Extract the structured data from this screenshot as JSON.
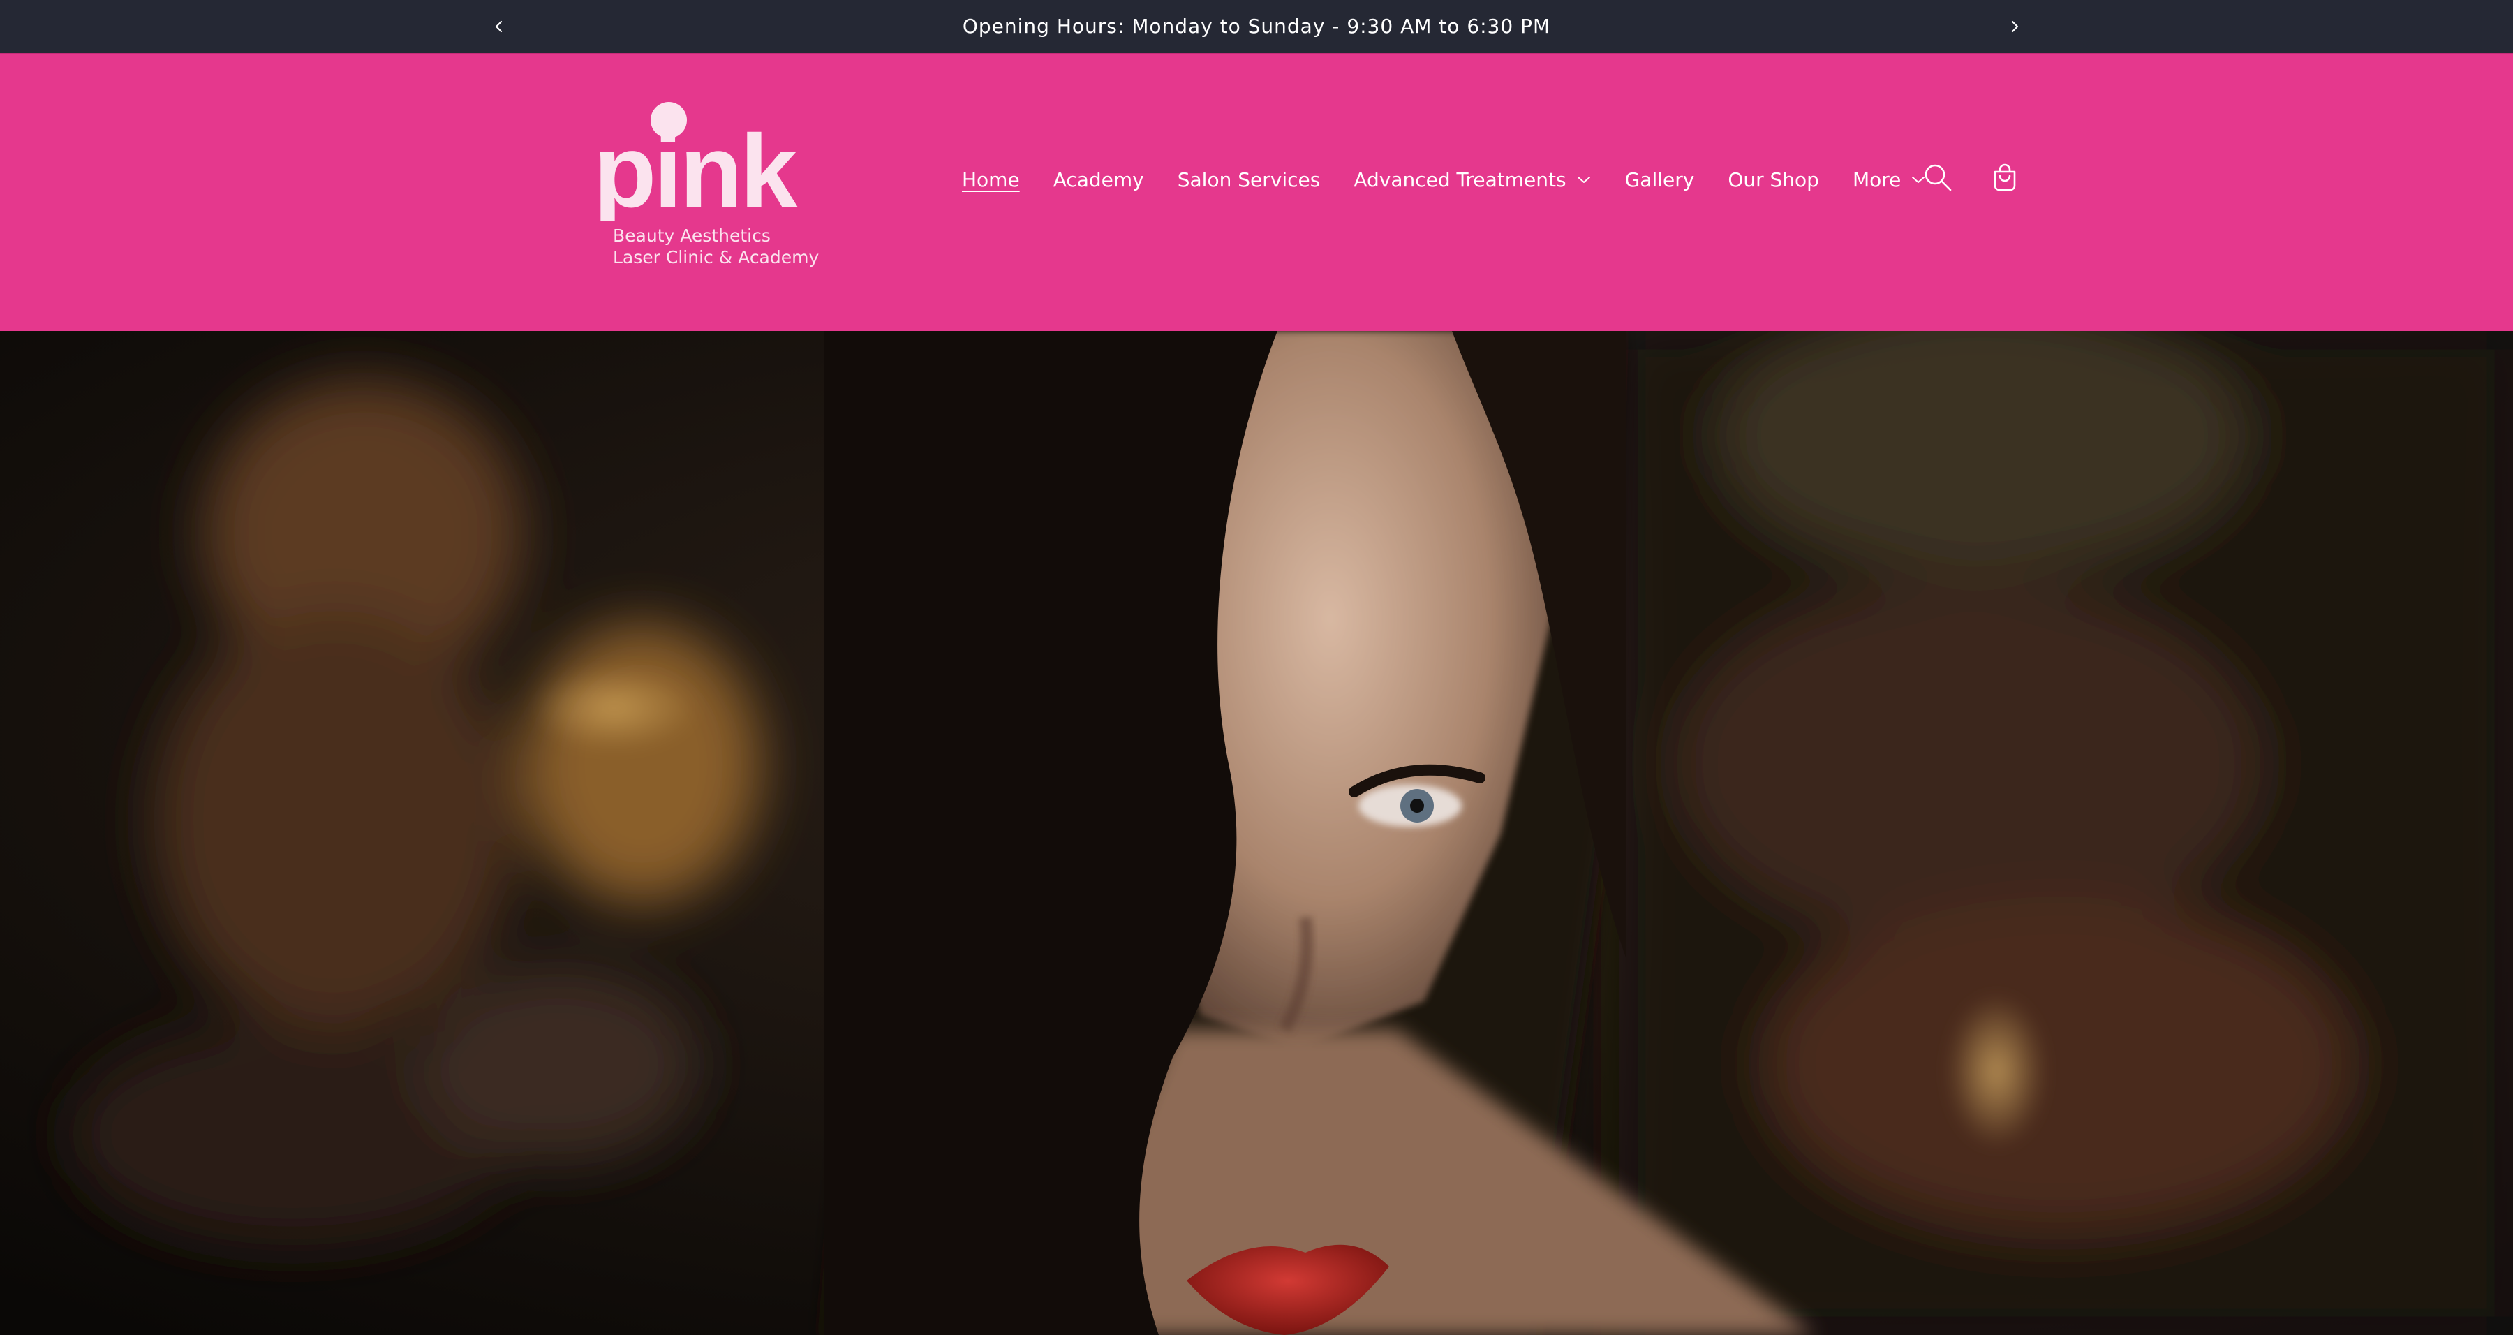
{
  "announcement": {
    "text": "Opening Hours: Monday to Sunday - 9:30 AM to 6:30 PM",
    "prev_icon": "chevron-left-icon",
    "next_icon": "chevron-right-icon"
  },
  "logo": {
    "wordmark": "pink",
    "tagline_line1": "Beauty Aesthetics",
    "tagline_line2": "Laser Clinic & Academy"
  },
  "nav": {
    "items": [
      {
        "label": "Home",
        "active": true,
        "has_dropdown": false
      },
      {
        "label": "Academy",
        "active": false,
        "has_dropdown": false
      },
      {
        "label": "Salon Services",
        "active": false,
        "has_dropdown": false
      },
      {
        "label": "Advanced Treatments",
        "active": false,
        "has_dropdown": true
      },
      {
        "label": "Gallery",
        "active": false,
        "has_dropdown": false
      },
      {
        "label": "Our Shop",
        "active": false,
        "has_dropdown": false
      },
      {
        "label": "More",
        "active": false,
        "has_dropdown": true
      }
    ]
  },
  "header_icons": {
    "search": "search-icon",
    "cart": "cart-icon"
  },
  "colors": {
    "announcement_bg": "#252834",
    "header_bg": "#e5388d",
    "logo_text": "#fbe3ee",
    "nav_text": "#ffffff"
  },
  "hero": {
    "media": "video-still-woman-red-lips"
  }
}
